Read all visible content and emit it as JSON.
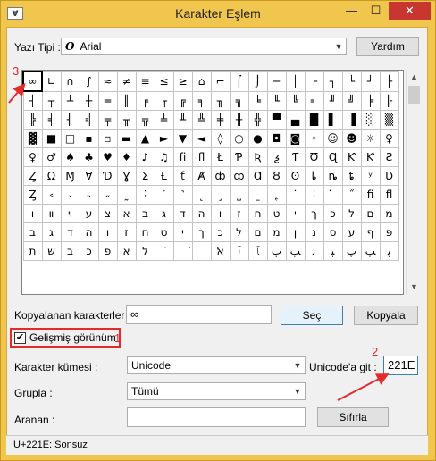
{
  "window": {
    "app_icon": "charmap-icon",
    "app_icon_text": "∀",
    "title": "Karakter Eşlem",
    "minimize": "—",
    "maximize": "☐",
    "close": "✕"
  },
  "font": {
    "label": "Yazı Tipi :",
    "font_glyph": "O",
    "value": "Arial",
    "help_button": "Yardım"
  },
  "grid": {
    "rows": [
      [
        "∞",
        "∟",
        "∩",
        "∫",
        "≈",
        "≠",
        "≡",
        "≤",
        "≥",
        "⌂",
        "⌐",
        "⌠",
        "⌡",
        "─",
        "│",
        "┌",
        "┐",
        "└",
        "┘",
        "├"
      ],
      [
        "┤",
        "┬",
        "┴",
        "┼",
        "═",
        "║",
        "╒",
        "╓",
        "╔",
        "╕",
        "╖",
        "╗",
        "╘",
        "╙",
        "╚",
        "╛",
        "╜",
        "╝",
        "╞",
        "╟"
      ],
      [
        "╠",
        "╡",
        "╢",
        "╣",
        "╤",
        "╥",
        "╦",
        "╧",
        "╨",
        "╩",
        "╪",
        "╫",
        "╬",
        "▀",
        "▄",
        "█",
        "▌",
        "▐",
        "░",
        "▒"
      ],
      [
        "▓",
        "■",
        "□",
        "▪",
        "▫",
        "▬",
        "▲",
        "►",
        "▼",
        "◄",
        "◊",
        "○",
        "●",
        "◘",
        "◙",
        "◦",
        "☺",
        "☻",
        "☼",
        "♀"
      ],
      [
        "♀",
        "♂",
        "♠",
        "♣",
        "♥",
        "♦",
        "♪",
        "♫",
        "ﬁ",
        "ﬂ",
        "Ł",
        "Ƥ",
        "Ʀ",
        "ƺ",
        "Ƭ",
        "Ʊ",
        "Ɋ",
        "Ƙ",
        "Ƙ",
        "Ƨ"
      ],
      [
        "Ȥ",
        "Ω",
        "Ɱ",
        "Ɐ",
        "Ɗ",
        "Ɣ",
        "Ʃ",
        "Ƚ",
        "ƭ",
        "Ⱥ",
        "ȸ",
        "ȹ",
        "Ɑ",
        "Ȣ",
        "ʘ",
        "ȴ",
        "ȵ",
        "ȶ",
        "ʸ",
        "Ʋ"
      ],
      [
        "Ȥ",
        "⸗",
        "˴",
        "˵",
        "˶",
        "˷",
        "˸",
        "˹",
        "˺",
        "˻",
        "˼",
        "˽",
        "˾",
        "˿",
        "˙",
        "˸",
        "̇",
        "˝",
        "ﬁ",
        "ﬂ"
      ],
      [
        "ו",
        "װ",
        "ױ",
        "ע",
        "צ",
        "א",
        "ב",
        "ג",
        "ד",
        "ה",
        "ו",
        "ז",
        "ח",
        "ט",
        "י",
        "ך",
        "כ",
        "ל",
        "ם",
        "מ"
      ],
      [
        "ב",
        "ג",
        "ד",
        "ה",
        "ו",
        "ז",
        "ח",
        "ט",
        "י",
        "ך",
        "כ",
        "ל",
        "ם",
        "מ",
        "ן",
        "נ",
        "ס",
        "ע",
        "ף",
        "פ"
      ],
      [
        "ת",
        "ש",
        "ב",
        "כ",
        "פ",
        "א",
        "ל",
        "ׂ",
        "ׁ",
        "ּ",
        "ﭏ",
        "ﭐ",
        "ﭑ",
        "ﭒ",
        "ﭓ",
        "ﭔ",
        "ﭕ",
        "ﭖ",
        "ﭗ",
        "ﭘ"
      ]
    ]
  },
  "copy": {
    "label": "Kopyalanan karakterler :",
    "value": "∞",
    "select_button": "Seç",
    "copy_button": "Kopyala"
  },
  "advanced": {
    "checkbox_label": "Gelişmiş görünüm",
    "check_mark": "✔"
  },
  "charset": {
    "label": "Karakter kümesi :",
    "value": "Unicode"
  },
  "goto": {
    "label": "Unicode'a git :",
    "value": "221E"
  },
  "group": {
    "label": "Grupla :",
    "value": "Tümü"
  },
  "search": {
    "label": "Aranan :",
    "value": "",
    "reset_button": "Sıfırla"
  },
  "status": {
    "text": "U+221E: Sonsuz"
  },
  "annotations": {
    "a1": "1",
    "a2": "2",
    "a3": "3",
    "color": "#e52a2a"
  }
}
